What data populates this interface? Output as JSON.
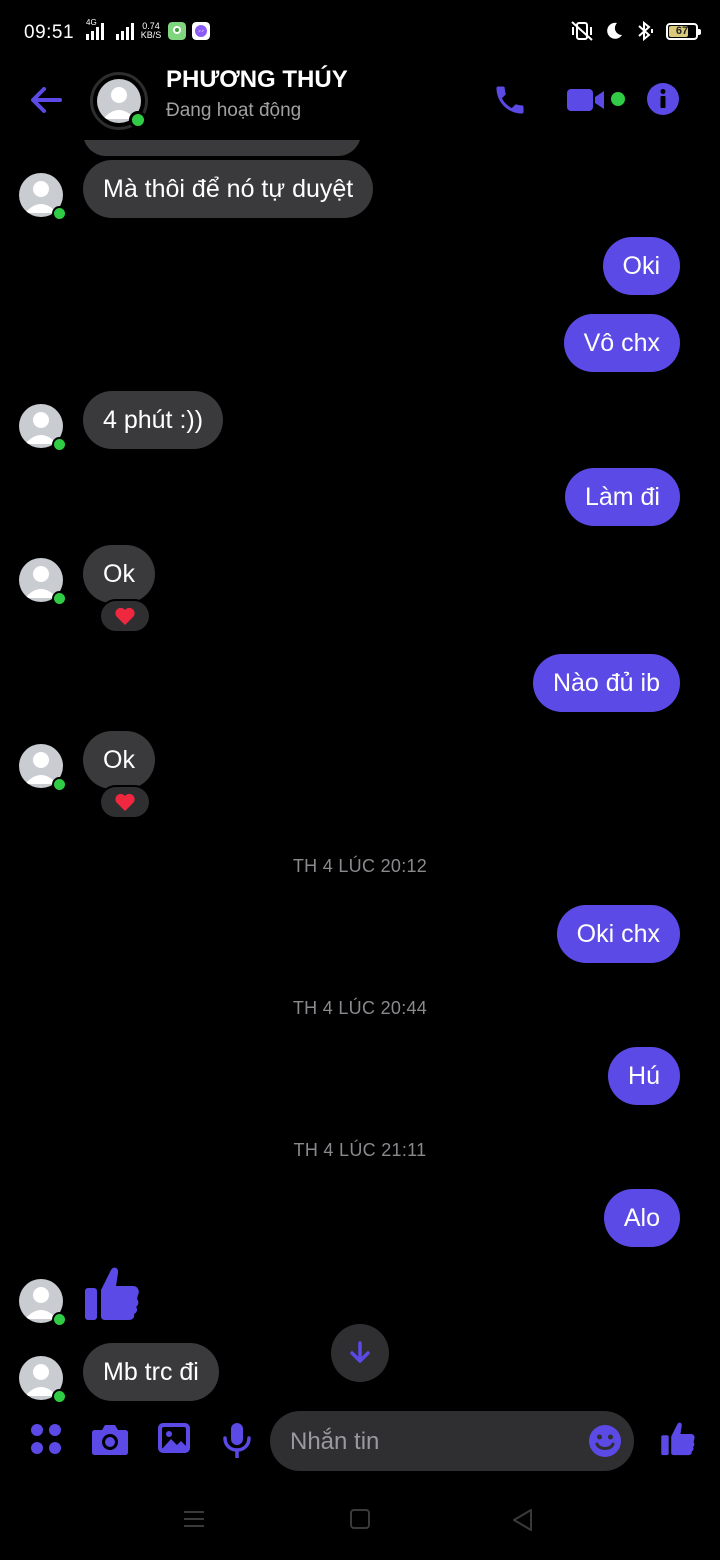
{
  "status_bar": {
    "time": "09:51",
    "network_label": "4G",
    "net_speed_value": "0.74",
    "net_speed_unit": "KB/S",
    "battery": "67"
  },
  "header": {
    "contact_name": "PHƯƠNG THÚY",
    "contact_status": "Đang hoạt động",
    "accent_color": "#5c4ae6",
    "online_color": "#31cc46"
  },
  "messages": [
    {
      "side": "in",
      "text": "Mà thôi để nó tự duyệt"
    },
    {
      "side": "out",
      "text": "Oki"
    },
    {
      "side": "out",
      "text": "Vô chx"
    },
    {
      "side": "in",
      "text": "4 phút :))"
    },
    {
      "side": "out",
      "text": "Làm đi"
    },
    {
      "side": "in",
      "text": "Ok",
      "reaction": "❤️"
    },
    {
      "side": "out",
      "text": "Nào đủ ib"
    },
    {
      "side": "in",
      "text": "Ok",
      "reaction": "❤️"
    },
    {
      "side": "out",
      "text": "Oki chx"
    },
    {
      "side": "out",
      "text": "Hú"
    },
    {
      "side": "out",
      "text": "Alo"
    },
    {
      "side": "in",
      "text": "Mb trc đi"
    }
  ],
  "timestamps": [
    "TH 4 LÚC 20:12",
    "TH 4 LÚC 20:44",
    "TH 4 LÚC 21:11"
  ],
  "composer": {
    "placeholder": "Nhắn tin"
  },
  "icons": {
    "back": "arrow-left-icon",
    "call": "phone-icon",
    "video": "video-camera-icon",
    "info": "info-icon",
    "menu": "four-dots-icon",
    "camera": "camera-icon",
    "gallery": "image-icon",
    "mic": "microphone-icon",
    "emoji": "smiley-icon",
    "like": "thumbs-up-icon",
    "scroll": "arrow-down-icon"
  }
}
